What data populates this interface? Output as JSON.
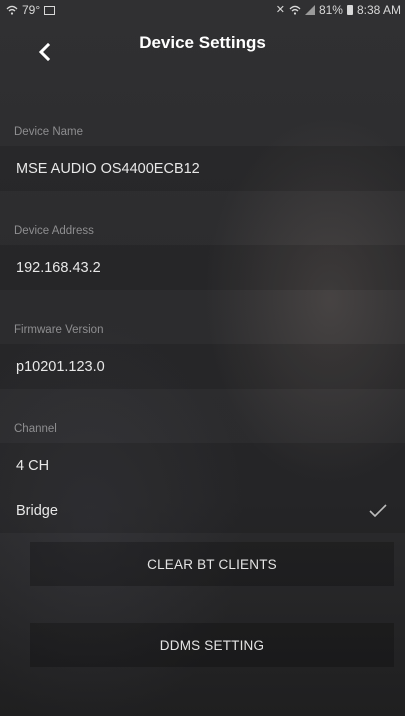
{
  "status_bar": {
    "left_temp": "79°",
    "battery": "81%",
    "time": "8:38 AM"
  },
  "header": {
    "title": "Device Settings",
    "back_icon": "chevron-left-icon"
  },
  "sections": {
    "device_name": {
      "label": "Device Name",
      "value": "MSE AUDIO OS4400ECB12"
    },
    "device_address": {
      "label": "Device Address",
      "value": "192.168.43.2"
    },
    "firmware_version": {
      "label": "Firmware Version",
      "value": "p10201.123.0"
    },
    "channel": {
      "label": "Channel",
      "options": [
        "4 CH",
        "Bridge"
      ],
      "selected": "Bridge"
    }
  },
  "buttons": {
    "clear_bt": "CLEAR BT CLIENTS",
    "ddms": "DDMS SETTING"
  },
  "colors": {
    "background": "#2b2b2d",
    "text_primary": "#e8e8e8",
    "label_gray": "#8e8e90",
    "check_color": "#bdbdbd"
  }
}
